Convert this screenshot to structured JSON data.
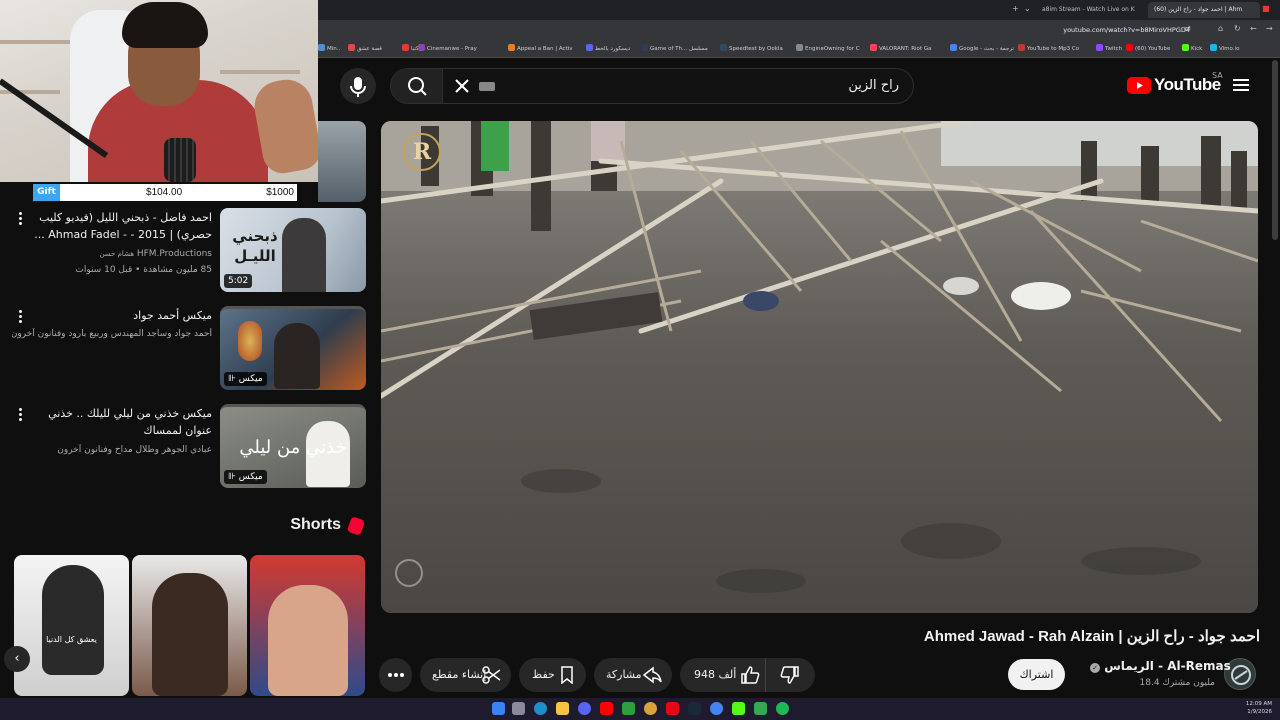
{
  "browser": {
    "tabs": [
      {
        "label": "a8im Stream - Watch Live on K",
        "active": false
      },
      {
        "label": "(60) احمد جواد - راح الزين | Ahm",
        "active": true
      }
    ],
    "url": "youtube.com/watch?v=b8MiroVHPGD4",
    "bookmarks": [
      {
        "label": "Min..",
        "color": "#4a90d9"
      },
      {
        "label": "قصة عشق",
        "color": "#d94a4a"
      },
      {
        "label": "كتبا",
        "color": "#e53935"
      },
      {
        "label": "Cinemanwe - Pray",
        "color": "#8e44ad"
      },
      {
        "label": "Appeal a Ban | Activ",
        "color": "#e67e22"
      },
      {
        "label": "ديسكورد بالخط",
        "color": "#5865f2"
      },
      {
        "label": "Game of Th... مسلسل",
        "color": "#2c3e50"
      },
      {
        "label": "Speedtest by Ookla",
        "color": "#34495e"
      },
      {
        "label": "EngineOwning for C",
        "color": "#7f8c8d"
      },
      {
        "label": "VALORANT: Riot Ga",
        "color": "#ff4655"
      },
      {
        "label": "Google - ترجمة - بحث",
        "color": "#4285f4"
      },
      {
        "label": "YouTube to Mp3 Co",
        "color": "#c0392b"
      },
      {
        "label": "Twitch",
        "color": "#9146ff"
      },
      {
        "label": "(60) YouTube",
        "color": "#ff0000"
      },
      {
        "label": "Kick",
        "color": "#53fc18"
      },
      {
        "label": "Vimo.io",
        "color": "#1ab7ea"
      }
    ]
  },
  "stream": {
    "gift_label": "Gift",
    "gift_current": "$104.00",
    "gift_goal": "$1000"
  },
  "header": {
    "search_value": "راح الزين",
    "logo_text": "YouTube",
    "region": "SA"
  },
  "video": {
    "title": "Ahmed Jawad - Rah Alzain | احمد جواد - راح الزين",
    "watermark": "R",
    "channel_name": "الريماس - Al-Remas",
    "channel_subs": "18.4 مليون مشترك",
    "subscribe_label": "اشتراك",
    "likes": "948 ألف",
    "share_label": "مشاركة",
    "save_label": "حفظ",
    "clip_label": "إنشاء مقطع"
  },
  "recommendations": [
    {
      "title": "احمد فاضل - ذبحني الليل (فيديو كليب حصري) | 2015 - - Ahmad Fadel ...",
      "channel": "HFM.Productions",
      "channel_ar": "هشام حسن",
      "stats": "85 مليون مشاهدة • قبل 10 سنوات",
      "badge": "5:02",
      "thumb_text": "ذبحني الليـل"
    },
    {
      "title": "ميكس أحمد جواد",
      "channel": "أحمد جواد وساجد المهندس وربيع بارود وفنانون آخرون",
      "stats": "",
      "badge": "ميكس",
      "thumb_text": ""
    },
    {
      "title": "ميكس خذني من ليلي لليلك .. خذني عنوان لممساك",
      "channel": "عبادي الجوهر وطلال مداح وفنانون آخرون",
      "stats": "",
      "badge": "ميكس",
      "thumb_text": "خذني من ليلي"
    }
  ],
  "shorts": {
    "label": "Shorts",
    "caption_1": "يعشق كل الدنيا"
  },
  "taskbar": {
    "time": "12:09 AM",
    "date": "1/9/2026"
  },
  "colors": {
    "background": "#0f0f0f",
    "accent": "#ff0000",
    "pill": "#272727",
    "gift_blue": "#3da5f5"
  }
}
